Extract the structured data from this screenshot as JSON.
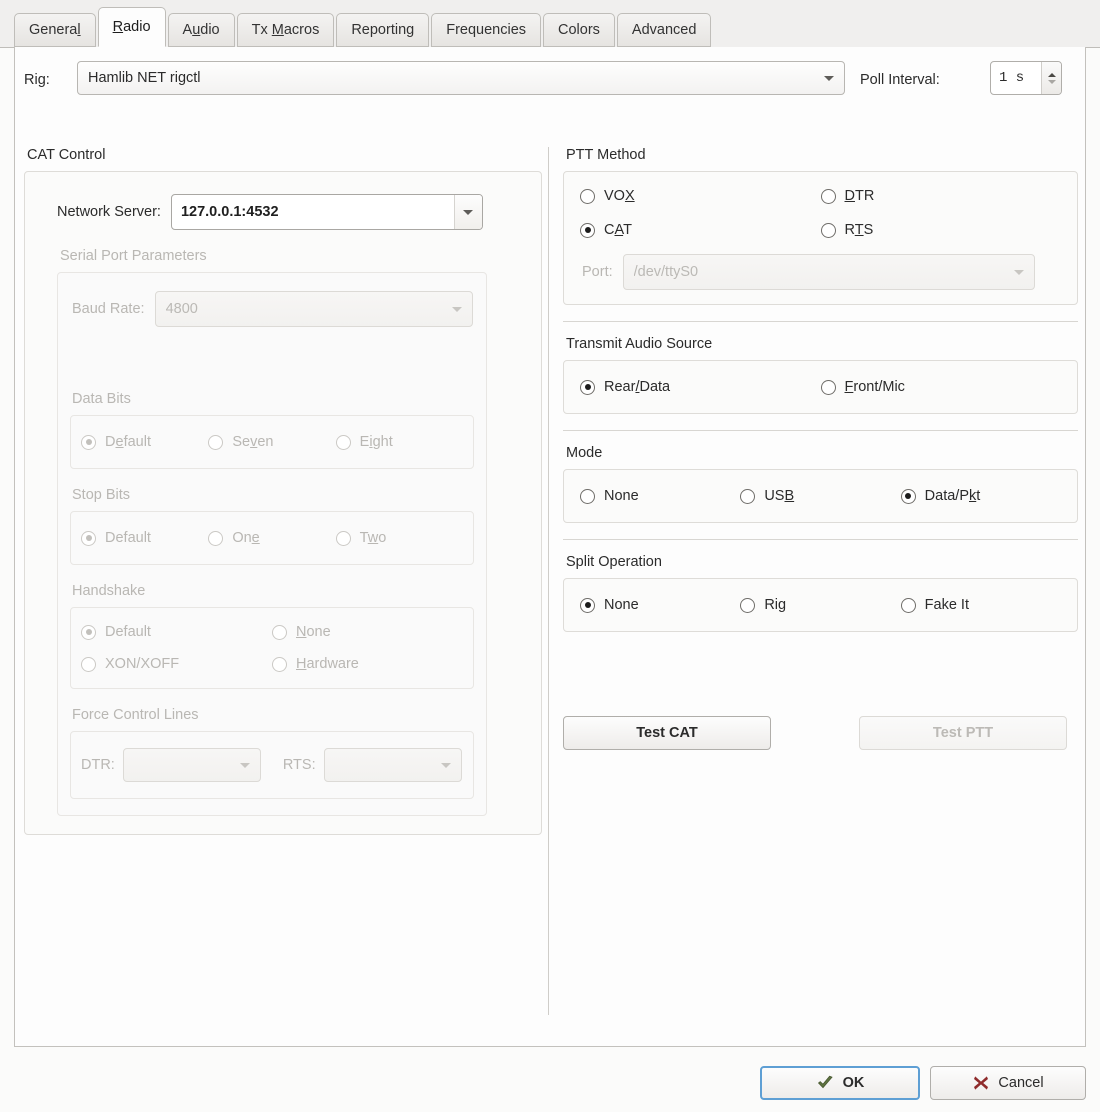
{
  "tabs": [
    {
      "label": "General",
      "pre": "Genera",
      "mn": "l",
      "post": "",
      "active": false
    },
    {
      "label": "Radio",
      "pre": "",
      "mn": "R",
      "post": "adio",
      "active": true
    },
    {
      "label": "Audio",
      "pre": "A",
      "mn": "u",
      "post": "dio",
      "active": false
    },
    {
      "label": "Tx Macros",
      "pre": "Tx ",
      "mn": "M",
      "post": "acros",
      "active": false
    },
    {
      "label": "Reporting",
      "pre": "Reportin",
      "mn": "g",
      "post": "",
      "active": false
    },
    {
      "label": "Frequencies",
      "pre": "Frequencies",
      "mn": "",
      "post": "",
      "active": false
    },
    {
      "label": "Colors",
      "pre": "Colors",
      "mn": "",
      "post": "",
      "active": false
    },
    {
      "label": "Advanced",
      "pre": "Advanced",
      "mn": "",
      "post": "",
      "active": false
    }
  ],
  "top": {
    "rig_label": "Rig:",
    "rig_value": "Hamlib NET rigctl",
    "poll_label": "Poll Interval:",
    "poll_value": "1 s"
  },
  "cat_control": {
    "title": "CAT Control",
    "network_server_label": "Network Server:",
    "network_server_value": "127.0.0.1:4532",
    "serial": {
      "title": "Serial Port Parameters",
      "enabled": false,
      "baud_label": "Baud Rate:",
      "baud_value": "4800",
      "data_bits": {
        "title": "Data Bits",
        "options": [
          {
            "pre": "D",
            "mn": "e",
            "post": "fault",
            "selected": true
          },
          {
            "pre": "Se",
            "mn": "v",
            "post": "en",
            "selected": false
          },
          {
            "pre": "E",
            "mn": "i",
            "post": "ght",
            "selected": false
          }
        ]
      },
      "stop_bits": {
        "title": "Stop Bits",
        "options": [
          {
            "pre": "Default",
            "mn": "",
            "post": "",
            "selected": true
          },
          {
            "pre": "On",
            "mn": "e",
            "post": "",
            "selected": false
          },
          {
            "pre": "T",
            "mn": "w",
            "post": "o",
            "selected": false
          }
        ]
      },
      "handshake": {
        "title": "Handshake",
        "options": [
          {
            "pre": "Default",
            "mn": "",
            "post": "",
            "selected": true
          },
          {
            "pre": "",
            "mn": "N",
            "post": "one",
            "selected": false
          },
          {
            "pre": "XON/XOFF",
            "mn": "",
            "post": "",
            "selected": false
          },
          {
            "pre": "",
            "mn": "H",
            "post": "ardware",
            "selected": false
          }
        ]
      },
      "force_control_lines": {
        "title": "Force Control Lines",
        "dtr_label": "DTR:",
        "dtr_value": "",
        "rts_label": "RTS:",
        "rts_value": ""
      }
    }
  },
  "ptt_method": {
    "title": "PTT Method",
    "options": [
      {
        "pre": "VO",
        "mn": "X",
        "post": "",
        "selected": false
      },
      {
        "pre": "",
        "mn": "D",
        "post": "TR",
        "selected": false
      },
      {
        "pre": "C",
        "mn": "A",
        "post": "T",
        "selected": true
      },
      {
        "pre": "R",
        "mn": "T",
        "post": "S",
        "selected": false
      }
    ],
    "port_label": "Port:",
    "port_value": "/dev/ttyS0",
    "port_enabled": false
  },
  "transmit_audio_source": {
    "title": "Transmit Audio Source",
    "options": [
      {
        "pre": "Rear",
        "mn": "/",
        "post": "Data",
        "selected": true
      },
      {
        "pre": "",
        "mn": "F",
        "post": "ront/Mic",
        "selected": false
      }
    ]
  },
  "mode": {
    "title": "Mode",
    "options": [
      {
        "pre": "None",
        "mn": "",
        "post": "",
        "selected": false
      },
      {
        "pre": "US",
        "mn": "B",
        "post": "",
        "selected": false
      },
      {
        "pre": "Data/P",
        "mn": "k",
        "post": "t",
        "selected": true
      }
    ]
  },
  "split_operation": {
    "title": "Split Operation",
    "options": [
      {
        "pre": "None",
        "mn": "",
        "post": "",
        "selected": true
      },
      {
        "pre": "Rig",
        "mn": "",
        "post": "",
        "selected": false
      },
      {
        "pre": "Fake It",
        "mn": "",
        "post": "",
        "selected": false
      }
    ]
  },
  "test_buttons": {
    "test_cat": "Test CAT",
    "test_cat_enabled": true,
    "test_ptt": "Test PTT",
    "test_ptt_enabled": false
  },
  "footer": {
    "ok_label": "OK",
    "ok_icon": "check-icon",
    "cancel_label": "Cancel",
    "cancel_icon": "x-icon"
  },
  "colors": {
    "focus_blue": "#5e9fd4",
    "ok_check_green": "#5e7340",
    "cancel_x_red": "#8f2b2b",
    "window_bg": "#fbfbfa",
    "page_bg": "#fdfdfd"
  }
}
